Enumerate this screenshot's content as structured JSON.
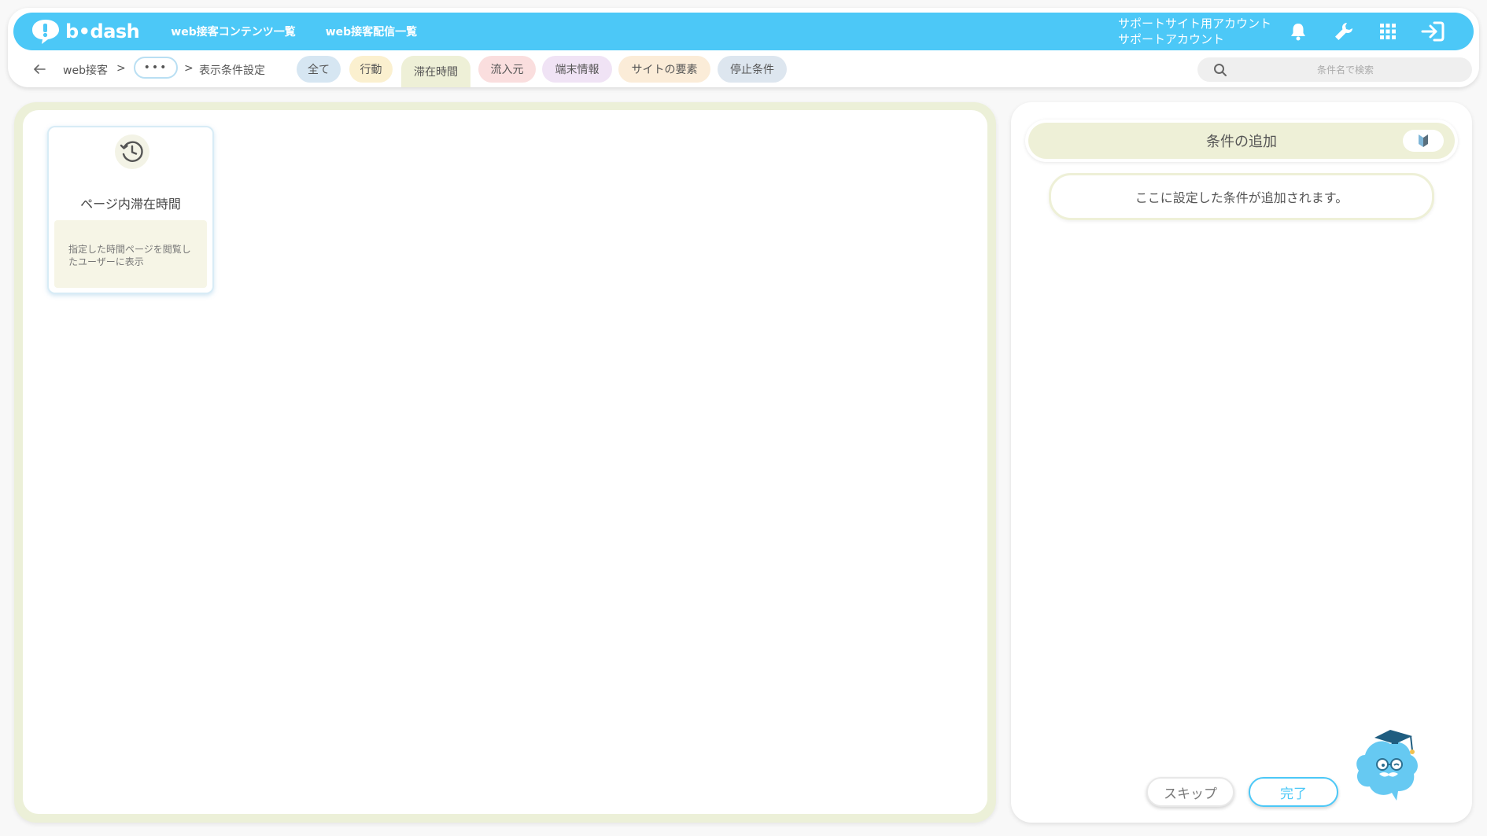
{
  "header": {
    "logo_text": "b•dash",
    "nav": [
      "web接客コンテンツ一覧",
      "web接客配信一覧"
    ],
    "account_line1": "サポートサイト用アカウント",
    "account_line2": "サポートアカウント"
  },
  "breadcrumb": {
    "root": "web接客",
    "sep": ">",
    "more": "•••",
    "current": "表示条件設定"
  },
  "tabs": [
    {
      "label": "全て",
      "color": "#d6e6f2"
    },
    {
      "label": "行動",
      "color": "#fbf0cf"
    },
    {
      "label": "滞在時間",
      "color": "#eef0d7"
    },
    {
      "label": "流入元",
      "color": "#fadede"
    },
    {
      "label": "端末情報",
      "color": "#f0e3f5"
    },
    {
      "label": "サイトの要素",
      "color": "#fbecd8"
    },
    {
      "label": "停止条件",
      "color": "#dde6ef"
    }
  ],
  "search": {
    "placeholder": "条件名で検索"
  },
  "card": {
    "icon": "clock-history-icon",
    "title": "ページ内滞在時間",
    "description": "指定した時間ページを閲覧したユーザーに表示"
  },
  "right": {
    "header": "条件の追加",
    "drop_zone": "ここに設定した条件が追加されます。",
    "skip": "スキップ",
    "done": "完了"
  },
  "colors": {
    "brand": "#4cc8f7",
    "panel": "#ecf0d8"
  }
}
